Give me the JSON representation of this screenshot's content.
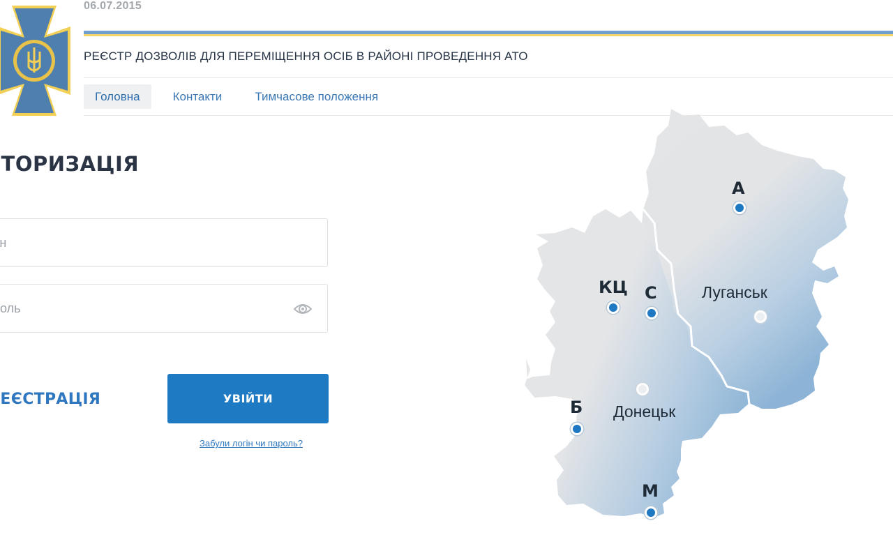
{
  "header": {
    "date": "06.07.2015",
    "title": "РЕЄСТР ДОЗВОЛІВ ДЛЯ ПЕРЕМІЩЕННЯ ОСІБ В РАЙОНІ ПРОВЕДЕННЯ АТО",
    "stripe_colors": [
      "#6f9fcf",
      "#f5d565"
    ]
  },
  "nav": {
    "items": [
      {
        "label": "Головна",
        "active": true
      },
      {
        "label": "Контакти",
        "active": false
      },
      {
        "label": "Тимчасове положення",
        "active": false
      }
    ]
  },
  "auth": {
    "title": "АВТОРИЗАЦІЯ",
    "login_placeholder": "Логін",
    "password_placeholder": "Пароль",
    "register_label": "РЕЄСТРАЦІЯ",
    "submit_label": "УВІЙТИ",
    "forgot_label": "Забули логін чи пароль?"
  },
  "map": {
    "labels": {
      "A": "А",
      "KC": "КЦ",
      "C": "С",
      "B": "Б",
      "M": "М",
      "luhansk": "Луганськ",
      "donetsk": "Донецьк"
    }
  },
  "colors": {
    "accent": "#1f7ac4",
    "link": "#2f78c0",
    "map_gray": "#e4e5e7",
    "map_blue": "#8db4d6"
  }
}
